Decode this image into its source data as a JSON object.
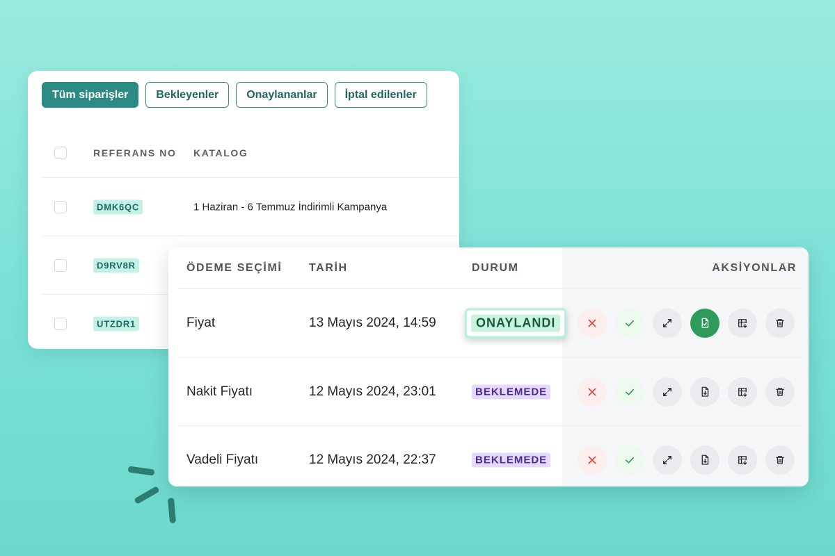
{
  "filters": [
    {
      "label": "Tüm siparişler",
      "active": true
    },
    {
      "label": "Bekleyenler",
      "active": false
    },
    {
      "label": "Onaylananlar",
      "active": false
    },
    {
      "label": "İptal edilenler",
      "active": false
    }
  ],
  "back_table": {
    "headers": {
      "ref": "REFERANS NO",
      "catalog": "KATALOG"
    },
    "rows": [
      {
        "ref": "DMK6QC",
        "catalog": "1 Haziran - 6 Temmuz İndirimli Kampanya"
      },
      {
        "ref": "D9RV8R",
        "catalog": ""
      },
      {
        "ref": "UTZDR1",
        "catalog": ""
      }
    ]
  },
  "front_table": {
    "headers": {
      "payment": "ÖDEME SEÇİMİ",
      "date": "TARİH",
      "status": "DURUM",
      "actions": "AKSİYONLAR"
    },
    "rows": [
      {
        "payment": "Fiyat",
        "date": "13 Mayıs 2024, 14:59",
        "status": "ONAYLANDI",
        "status_type": "approved"
      },
      {
        "payment": "Nakit Fiyatı",
        "date": "12 Mayıs 2024, 23:01",
        "status": "BEKLEMEDE",
        "status_type": "pending"
      },
      {
        "payment": "Vadeli Fiyatı",
        "date": "12 Mayıs 2024, 22:37",
        "status": "BEKLEMEDE",
        "status_type": "pending"
      }
    ]
  },
  "action_icons": [
    "close-icon",
    "check-icon",
    "expand-icon",
    "file-check-icon",
    "table-download-icon",
    "trash-icon"
  ],
  "colors": {
    "accent": "#2b8b83",
    "approved_bg": "#c9f3dc",
    "pending_bg": "#e4d8fb",
    "reject": "#e0453f",
    "accept": "#3aa05a",
    "primary_action": "#2e9a5b"
  }
}
